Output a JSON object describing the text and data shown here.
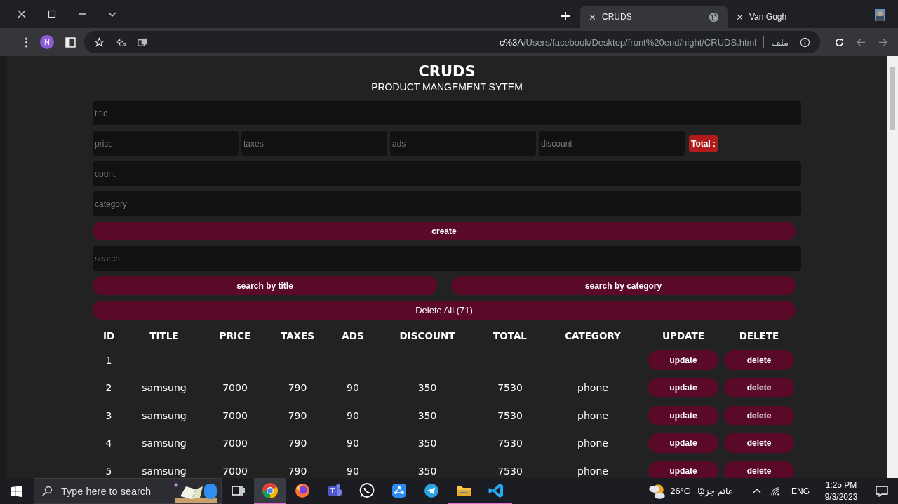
{
  "browser": {
    "tabs": [
      {
        "title": "CRUDS",
        "selected": true
      },
      {
        "title": "Van Gogh",
        "selected": false
      }
    ],
    "profile_initial": "N",
    "address": {
      "host": "c%3A",
      "path": "/Users/facebook/Desktop/front%20end/night/CRUDS.html",
      "scheme_label": "ملف"
    }
  },
  "page": {
    "title": "CRUDS",
    "subtitle": "PRODUCT MANGEMENT SYTEM",
    "title_field": {
      "placeholder": "title"
    },
    "price_fields": [
      {
        "placeholder": "price"
      },
      {
        "placeholder": "taxes"
      },
      {
        "placeholder": "ads"
      },
      {
        "placeholder": "discount"
      }
    ],
    "total_label": "Total :",
    "count_field": {
      "placeholder": "count"
    },
    "category_field": {
      "placeholder": "category"
    },
    "create_button": "create",
    "search_field": {
      "placeholder": "search"
    },
    "search_buttons": [
      "search by title",
      "search by category"
    ],
    "delete_all_button": "Delete All (71)",
    "table": {
      "columns": [
        "ID",
        "TITLE",
        "PRICE",
        "TAXES",
        "ADS",
        "DISCOUNT",
        "TOTAL",
        "CATEGORY",
        "UPDATE",
        "DELETE"
      ],
      "rows": [
        {
          "id": "1",
          "update": "update",
          "delete": "delete"
        },
        {
          "id": "2",
          "title": "samsung",
          "price": "7000",
          "taxes": "790",
          "ads": "90",
          "discount": "350",
          "total": "7530",
          "category": "phone",
          "update": "update",
          "delete": "delete"
        },
        {
          "id": "3",
          "title": "samsung",
          "price": "7000",
          "taxes": "790",
          "ads": "90",
          "discount": "350",
          "total": "7530",
          "category": "phone",
          "update": "update",
          "delete": "delete"
        },
        {
          "id": "4",
          "title": "samsung",
          "price": "7000",
          "taxes": "790",
          "ads": "90",
          "discount": "350",
          "total": "7530",
          "category": "phone",
          "update": "update",
          "delete": "delete"
        },
        {
          "id": "5",
          "title": "samsung",
          "price": "7000",
          "taxes": "790",
          "ads": "90",
          "discount": "350",
          "total": "7530",
          "category": "phone",
          "update": "update",
          "delete": "delete"
        }
      ]
    }
  },
  "taskbar": {
    "search": {
      "placeholder": "Type here to search"
    },
    "apps": [
      {
        "kind": "taskview",
        "open": false,
        "selected": false
      },
      {
        "kind": "chrome",
        "open": true,
        "selected": true
      },
      {
        "kind": "firefox",
        "open": false,
        "selected": false
      },
      {
        "kind": "teams",
        "open": false,
        "selected": false
      },
      {
        "kind": "whatsapp",
        "open": false,
        "selected": false
      },
      {
        "kind": "share",
        "open": false,
        "selected": false
      },
      {
        "kind": "telegram",
        "open": false,
        "selected": false
      },
      {
        "kind": "explorer",
        "open": true,
        "selected": false
      },
      {
        "kind": "vscode",
        "open": true,
        "selected": false
      }
    ],
    "weather": {
      "temperature": "26°C",
      "condition": "غائم جزئيًا"
    },
    "language": "ENG",
    "time": "1:25 PM",
    "date": "9/3/2023"
  }
}
